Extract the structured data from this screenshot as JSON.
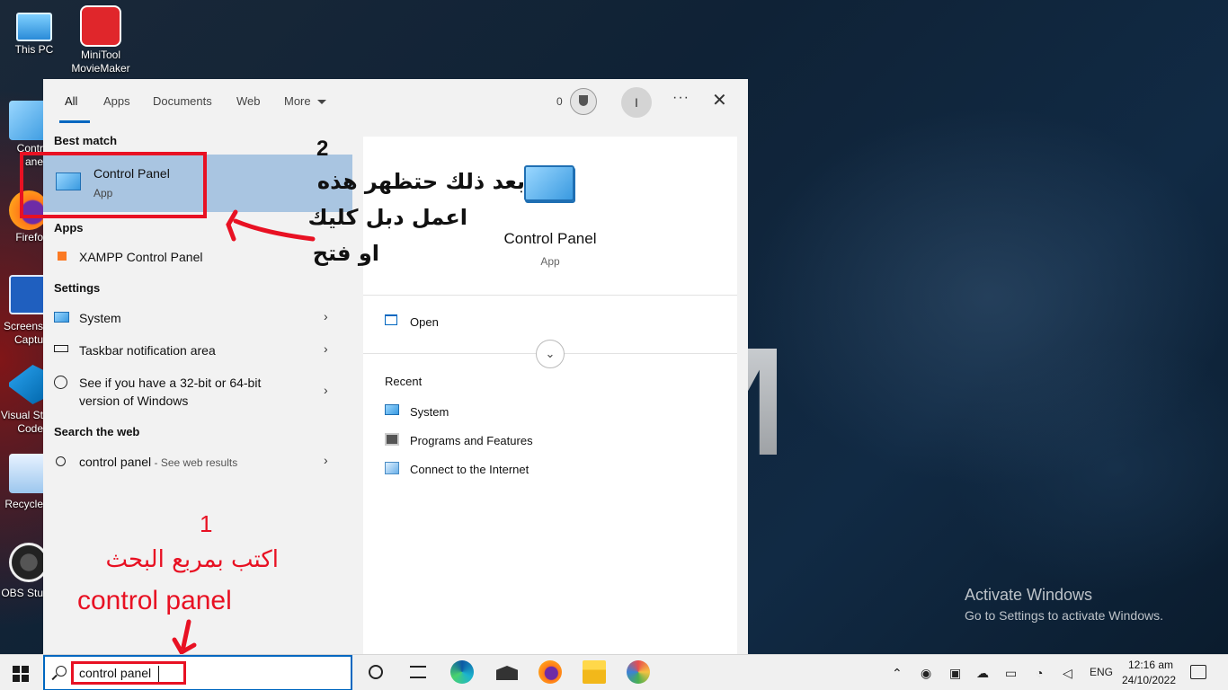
{
  "desktop": {
    "icons": [
      {
        "label_line1": "This PC",
        "label_line2": ""
      },
      {
        "label_line1": "MiniTool",
        "label_line2": "MovieMaker"
      }
    ],
    "side_labels": [
      "Contr",
      "ane",
      "Firefo",
      "Screens",
      "Captu",
      "Visual St",
      "Code",
      "Recycle",
      "OBS Stu"
    ]
  },
  "search_panel": {
    "tabs": {
      "all": "All",
      "apps": "Apps",
      "documents": "Documents",
      "web": "Web",
      "more": "More"
    },
    "points": "0",
    "avatar_initial": "I",
    "more_options": "···",
    "close": "✕",
    "sections": {
      "best_match": "Best match",
      "apps": "Apps",
      "settings": "Settings",
      "search_web": "Search the web"
    },
    "best_match": {
      "title": "Control Panel",
      "subtitle": "App"
    },
    "apps_items": [
      {
        "prefix": "XAMPP ",
        "bold": "Control Panel"
      }
    ],
    "settings_items": [
      {
        "label": "System"
      },
      {
        "label": "Taskbar notification area"
      },
      {
        "label_line1": "See if you have a 32-bit or 64-bit",
        "label_line2": "version of Windows"
      }
    ],
    "web_item": {
      "query": "control panel",
      "suffix": " - See web results"
    },
    "chevron": "›",
    "detail": {
      "title": "Control Panel",
      "subtitle": "App",
      "open_label": "Open",
      "expand": "⌄",
      "recent_heading": "Recent",
      "recent_items": [
        "System",
        "Programs and Features",
        "Connect to the Internet"
      ]
    }
  },
  "annotations": {
    "step2_number": "2",
    "step2_line1": "بعد ذلك حتظهر هذه",
    "step2_line2": "اعمل دبل كليك",
    "step2_line3": "او فتح",
    "step1_number": "1",
    "step1_line1": "اكتب بمربع البحث",
    "step1_line2": "control panel",
    "accent_color": "#e81123"
  },
  "watermark": {
    "title": "Activate Windows",
    "subtitle": "Go to Settings to activate Windows."
  },
  "taskbar": {
    "search_value": "control panel",
    "tray": {
      "language": "ENG",
      "time": "12:16 am",
      "date": "24/10/2022"
    }
  }
}
